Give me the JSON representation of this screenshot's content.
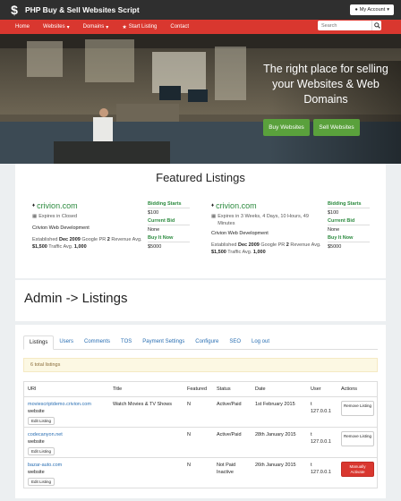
{
  "header": {
    "brand": "PHP Buy & Sell Websites Script",
    "account_label": "My Account"
  },
  "nav": {
    "items": [
      {
        "label": "Home"
      },
      {
        "label": "Websites",
        "dropdown": true
      },
      {
        "label": "Domains",
        "dropdown": true
      },
      {
        "label": "Start Listing",
        "icon": "star-icon"
      },
      {
        "label": "Contact"
      }
    ],
    "search_placeholder": "Search"
  },
  "hero": {
    "title": "The right place for selling your Websites & Web Domains",
    "buy_label": "Buy Websites",
    "sell_label": "Sell Websites"
  },
  "featured": {
    "title": "Featured Listings",
    "listings": [
      {
        "domain": "crivion.com",
        "expires": "Expires in Closed",
        "owner": "Crivion Web Development",
        "established_label": "Established",
        "established": "Dec 2009",
        "pr_label": "Google PR",
        "pr": "2",
        "revenue_label": "Revenue Avg.",
        "revenue": "$1,500",
        "traffic_label": "Traffic Avg.",
        "traffic": "1,000",
        "bidding_starts_label": "Bidding Starts",
        "bidding_starts": "$100",
        "current_bid_label": "Current Bid",
        "current_bid": "None",
        "buy_now_label": "Buy It Now",
        "buy_now": "$5000"
      },
      {
        "domain": "crivion.com",
        "expires": "Expires in 3 Weeks, 4 Days, 10 Hours, 49 Minutes",
        "owner": "Crivion Web Development",
        "established_label": "Established",
        "established": "Dec 2009",
        "pr_label": "Google PR",
        "pr": "2",
        "revenue_label": "Revenue Avg.",
        "revenue": "$1,500",
        "traffic_label": "Traffic Avg.",
        "traffic": "1,000",
        "bidding_starts_label": "Bidding Starts",
        "bidding_starts": "$100",
        "current_bid_label": "Current Bid",
        "current_bid": "None",
        "buy_now_label": "Buy It Now",
        "buy_now": "$5000"
      }
    ]
  },
  "admin": {
    "title": "Admin -> Listings",
    "tabs": [
      "Listings",
      "Users",
      "Comments",
      "TOS",
      "Payment Settings",
      "Configure",
      "SEO",
      "Log out"
    ],
    "alert": "6 total listings",
    "columns": [
      "URI",
      "Title",
      "Featured",
      "Status",
      "Date",
      "User",
      "Actions"
    ],
    "rows": [
      {
        "uri": "moviescriptdemo.crivion.com",
        "type": "website",
        "edit": "Edit Listing",
        "title": "Watch Movies & TV Shows",
        "featured": "N",
        "status": "Active/Paid",
        "date": "1st February 2015",
        "user_l1": "t",
        "user_l2": "127.0.0.1",
        "action": "Remove Listing",
        "action_style": "default"
      },
      {
        "uri": "codecanyon.net",
        "type": "website",
        "edit": "Edit Listing",
        "title": "",
        "featured": "N",
        "status": "Active/Paid",
        "date": "28th January 2015",
        "user_l1": "t",
        "user_l2": "127.0.0.1",
        "action": "Remove Listing",
        "action_style": "default"
      },
      {
        "uri": "bazar-auto.com",
        "type": "website",
        "edit": "Edit Listing",
        "title": "",
        "featured": "N",
        "status": "Not Paid Inactive",
        "date": "26th January 2015",
        "user_l1": "t",
        "user_l2": "127.0.0.1",
        "action": "Manually Activate",
        "action_style": "danger"
      }
    ]
  },
  "colors": {
    "topbar": "#2f2f2f",
    "navbar": "#d9372f",
    "accent_green": "#5aa13c",
    "link_blue": "#2a6fb3",
    "domain_green": "#2b8a3e"
  }
}
